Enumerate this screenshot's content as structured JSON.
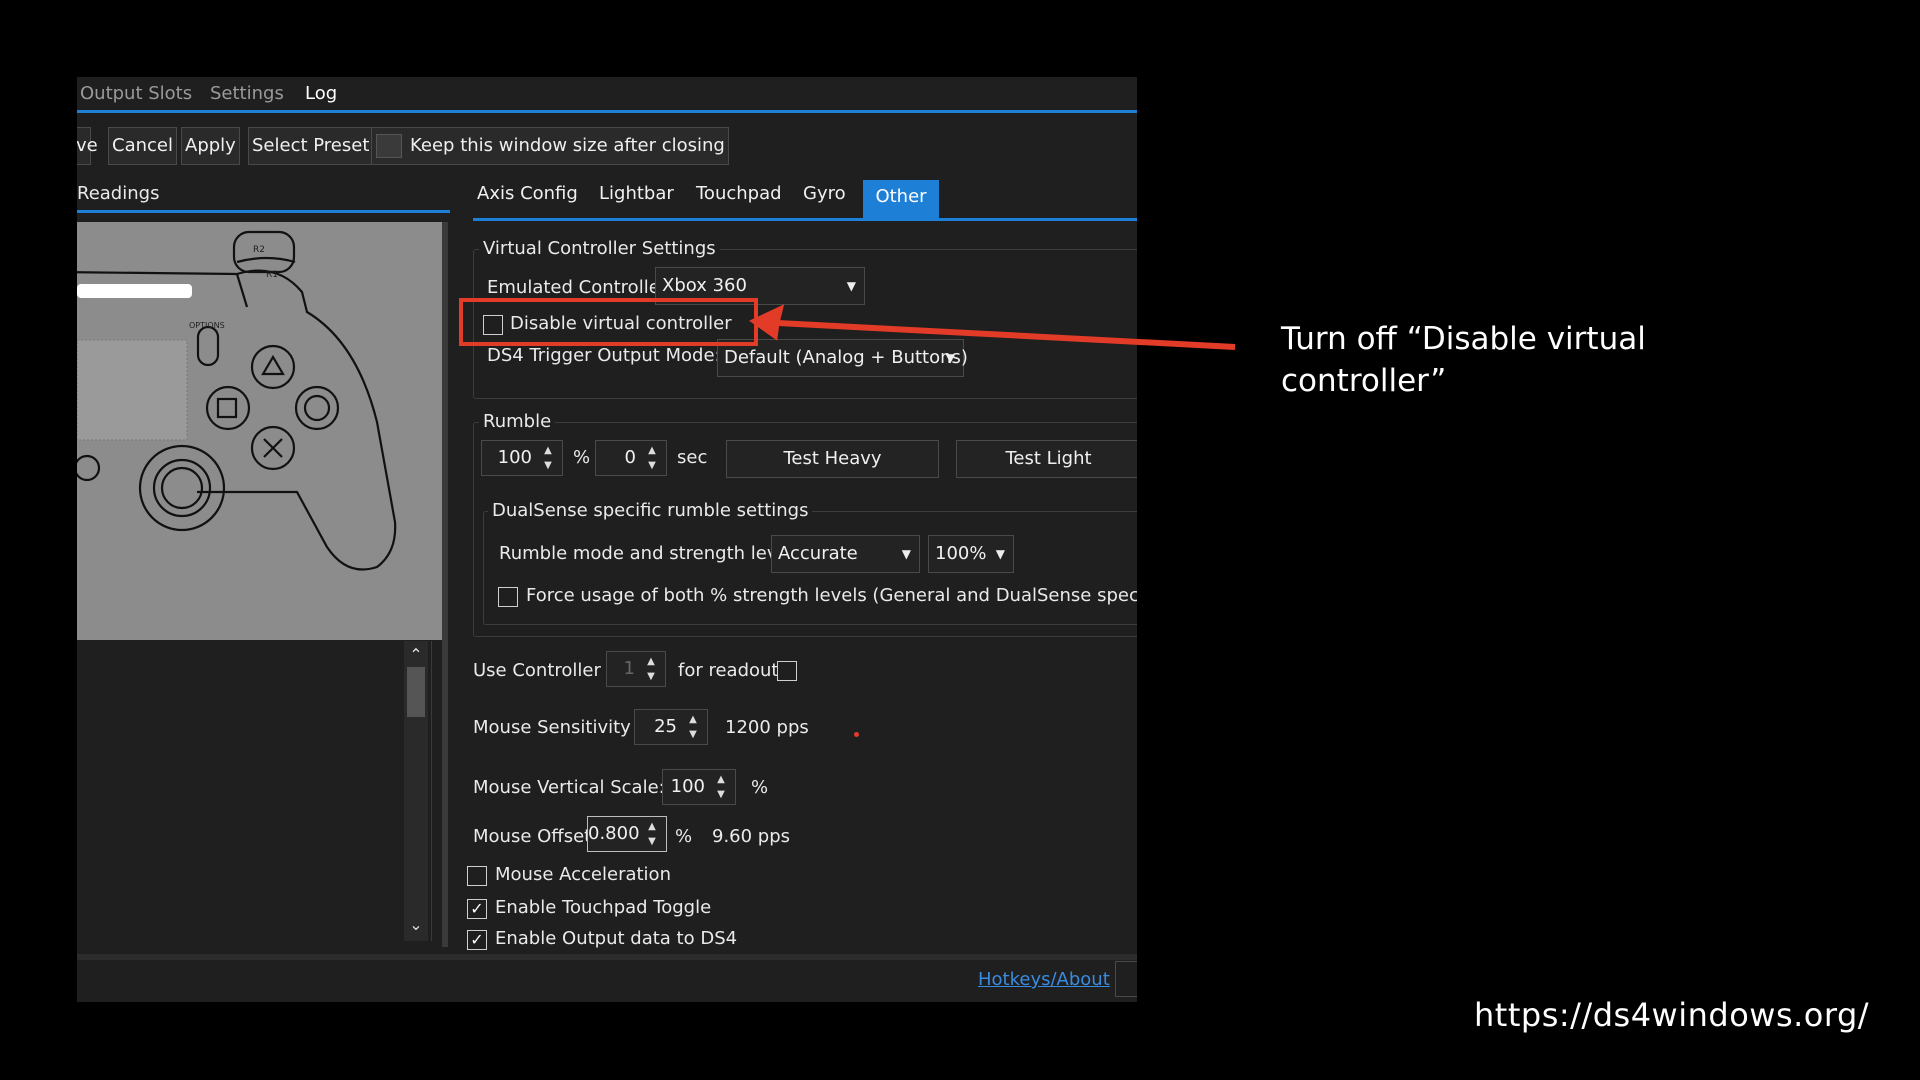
{
  "menu": {
    "items": [
      {
        "label": "Output Slots"
      },
      {
        "label": "Settings"
      },
      {
        "label": "Log"
      }
    ]
  },
  "toolbar": {
    "save_label": "ve",
    "cancel_label": "Cancel",
    "apply_label": "Apply",
    "select_preset_label": "Select Preset",
    "keep_size_label": "Keep this window size after closing"
  },
  "left_panel": {
    "tab_label": "Readings",
    "controller_labels": {
      "r2": "R2",
      "r1": "R1",
      "options": "OPTIONS"
    }
  },
  "tabs": [
    {
      "label": "Axis Config"
    },
    {
      "label": "Lightbar"
    },
    {
      "label": "Touchpad"
    },
    {
      "label": "Gyro"
    },
    {
      "label": "Other"
    }
  ],
  "virtual_controller": {
    "title": "Virtual Controller Settings",
    "emulated_label": "Emulated Controller",
    "emulated_value": "Xbox 360",
    "disable_label": "Disable virtual controller",
    "disable_checked": false,
    "trigger_label": "DS4 Trigger Output Mode:",
    "trigger_value": "Default (Analog + Buttons)"
  },
  "rumble": {
    "title": "Rumble",
    "percent_value": "100",
    "percent_unit": "%",
    "sec_value": "0",
    "sec_unit": "sec",
    "test_heavy_label": "Test Heavy",
    "test_light_label": "Test Light",
    "dualsense": {
      "title": "DualSense specific rumble settings",
      "mode_label": "Rumble mode and strength level:",
      "mode_value": "Accurate",
      "strength_value": "100%",
      "force_label": "Force usage of both % strength levels (General and DualSense specifc)",
      "force_checked": false
    }
  },
  "controller_use": {
    "use_label": "Use Controller",
    "use_value": "1",
    "readout_label": "for readout"
  },
  "mouse": {
    "sensitivity_label": "Mouse Sensitivity",
    "sensitivity_value": "25",
    "sensitivity_pps": "1200 pps",
    "vertical_label": "Mouse Vertical Scale:",
    "vertical_value": "100",
    "vertical_unit": "%",
    "offset_label": "Mouse Offset",
    "offset_value": "0.800",
    "offset_unit": "%",
    "offset_pps": "9.60 pps",
    "accel_label": "Mouse Acceleration",
    "accel_checked": false
  },
  "options": {
    "touchpad_toggle_label": "Enable Touchpad Toggle",
    "touchpad_toggle_checked": true,
    "output_ds4_label": "Enable Output data to DS4",
    "output_ds4_checked": true
  },
  "footer": {
    "hotkeys_label": "Hotkeys/About"
  },
  "annotation": {
    "text": "Turn off “Disable virtual controller”",
    "highlight_color": "#e23b28"
  },
  "site_url": "https://ds4windows.org/",
  "colors": {
    "accent": "#1e7fd6",
    "background": "#1f1f1f",
    "annotation": "#e23b28"
  }
}
